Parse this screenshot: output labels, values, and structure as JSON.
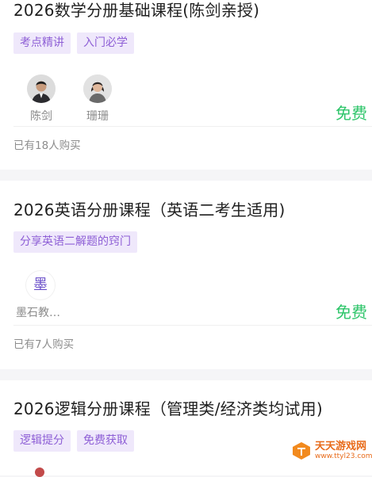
{
  "courses": [
    {
      "title": "2026数学分册基础课程(陈剑亲授)",
      "tags": [
        "考点精讲",
        "入门必学"
      ],
      "teachers": [
        "陈剑",
        "珊珊"
      ],
      "price": "免费",
      "bought": "已有18人购买"
    },
    {
      "title": "2026英语分册课程（英语二考生适用)",
      "tags": [
        "分享英语二解题的窍门"
      ],
      "teachers": [
        "墨石教…"
      ],
      "teacher_logo": "墨",
      "price": "免费",
      "bought": "已有7人购买"
    },
    {
      "title": "2026逻辑分册课程（管理类/经济类均试用)",
      "tags": [
        "逻辑提分",
        "免费获取"
      ]
    }
  ],
  "watermark": {
    "name": "天天游戏网",
    "url": "www.ttyl23.com"
  },
  "colors": {
    "tag_bg": "#efe8fb",
    "tag_text": "#8e5fd6",
    "price": "#2ec56a"
  }
}
